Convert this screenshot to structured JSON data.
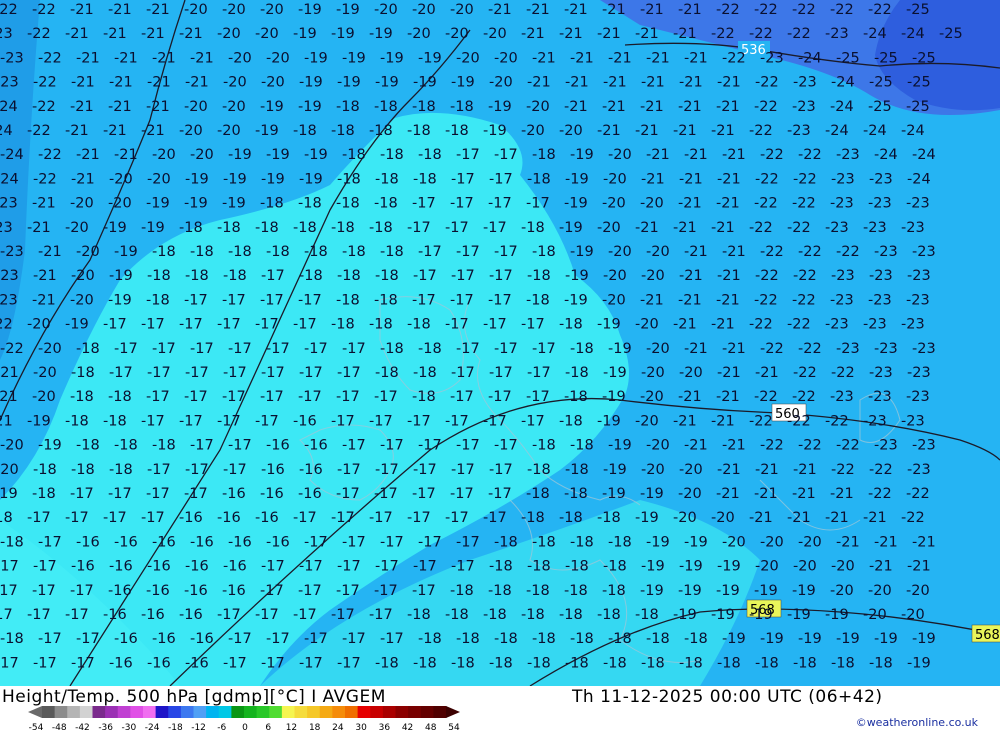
{
  "header": {
    "title_left": "Height/Temp. 500 hPa [gdmp][°C] I AVGEM",
    "title_right": "Th 11-12-2025 00:00 UTC (06+42)",
    "credit": "©weatheronline.co.uk"
  },
  "colorbar": {
    "labels": [
      "-54",
      "-48",
      "-42",
      "-36",
      "-30",
      "-24",
      "-18",
      "-12",
      "-6",
      "0",
      "6",
      "12",
      "18",
      "24",
      "30",
      "36",
      "42",
      "48",
      "54"
    ],
    "colors": [
      "#5a5a5a",
      "#8c8c8c",
      "#b4b4b4",
      "#d2d2d2",
      "#7a2a8c",
      "#9b30b4",
      "#c040d2",
      "#e050e6",
      "#f06ef0",
      "#1e14c8",
      "#2846e6",
      "#3c78f0",
      "#50a0f5",
      "#00b4f0",
      "#00c8e6",
      "#0a9614",
      "#14b41e",
      "#28c828",
      "#50dc32",
      "#f5f550",
      "#f5dc3c",
      "#f5c828",
      "#f5aa14",
      "#f58c0a",
      "#f06e00",
      "#e60000",
      "#c80000",
      "#aa0000",
      "#8c0000",
      "#780000",
      "#640000",
      "#500000"
    ]
  },
  "contour_labels": [
    "536",
    "560",
    "568",
    "568"
  ],
  "temperature_grid": [
    [
      "-22",
      "-22",
      "-21",
      "-21",
      "-21",
      "-20",
      "-20",
      "-20",
      "-19",
      "-19",
      "-20",
      "-20",
      "-20",
      "-21",
      "-21",
      "-21",
      "-21",
      "-21",
      "-21",
      "-22",
      "-22",
      "-22",
      "-22",
      "-22",
      "-25"
    ],
    [
      "-23",
      "-22",
      "-21",
      "-21",
      "-21",
      "-21",
      "-20",
      "-20",
      "-19",
      "-19",
      "-19",
      "-20",
      "-20",
      "-20",
      "-21",
      "-21",
      "-21",
      "-21",
      "-21",
      "-22",
      "-22",
      "-22",
      "-23",
      "-24",
      "-24",
      "-25"
    ],
    [
      "-23",
      "-22",
      "-21",
      "-21",
      "-21",
      "-21",
      "-20",
      "-20",
      "-19",
      "-19",
      "-19",
      "-19",
      "-20",
      "-20",
      "-21",
      "-21",
      "-21",
      "-21",
      "-21",
      "-22",
      "-23",
      "-24",
      "-25",
      "-25",
      "-25"
    ],
    [
      "-23",
      "-22",
      "-21",
      "-21",
      "-21",
      "-21",
      "-20",
      "-20",
      "-19",
      "-19",
      "-19",
      "-19",
      "-19",
      "-20",
      "-21",
      "-21",
      "-21",
      "-21",
      "-21",
      "-21",
      "-22",
      "-23",
      "-24",
      "-25",
      "-25"
    ],
    [
      "-24",
      "-22",
      "-21",
      "-21",
      "-21",
      "-20",
      "-20",
      "-19",
      "-19",
      "-18",
      "-18",
      "-18",
      "-18",
      "-19",
      "-20",
      "-21",
      "-21",
      "-21",
      "-21",
      "-21",
      "-22",
      "-23",
      "-24",
      "-25",
      "-25"
    ],
    [
      "-24",
      "-22",
      "-21",
      "-21",
      "-21",
      "-20",
      "-20",
      "-19",
      "-18",
      "-18",
      "-18",
      "-18",
      "-18",
      "-19",
      "-20",
      "-20",
      "-21",
      "-21",
      "-21",
      "-21",
      "-22",
      "-23",
      "-24",
      "-24",
      "-24"
    ],
    [
      "-24",
      "-22",
      "-21",
      "-21",
      "-20",
      "-20",
      "-19",
      "-19",
      "-19",
      "-18",
      "-18",
      "-18",
      "-17",
      "-17",
      "-18",
      "-19",
      "-20",
      "-21",
      "-21",
      "-21",
      "-22",
      "-22",
      "-23",
      "-24",
      "-24"
    ],
    [
      "-24",
      "-22",
      "-21",
      "-20",
      "-20",
      "-19",
      "-19",
      "-19",
      "-19",
      "-18",
      "-18",
      "-18",
      "-17",
      "-17",
      "-18",
      "-19",
      "-20",
      "-21",
      "-21",
      "-21",
      "-22",
      "-22",
      "-23",
      "-23",
      "-24"
    ],
    [
      "-23",
      "-21",
      "-20",
      "-20",
      "-19",
      "-19",
      "-19",
      "-18",
      "-18",
      "-18",
      "-18",
      "-17",
      "-17",
      "-17",
      "-17",
      "-19",
      "-20",
      "-20",
      "-21",
      "-21",
      "-22",
      "-22",
      "-23",
      "-23",
      "-23"
    ],
    [
      "-23",
      "-21",
      "-20",
      "-19",
      "-19",
      "-18",
      "-18",
      "-18",
      "-18",
      "-18",
      "-18",
      "-17",
      "-17",
      "-17",
      "-18",
      "-19",
      "-20",
      "-21",
      "-21",
      "-21",
      "-22",
      "-22",
      "-23",
      "-23",
      "-23"
    ],
    [
      "-23",
      "-21",
      "-20",
      "-19",
      "-18",
      "-18",
      "-18",
      "-18",
      "-18",
      "-18",
      "-18",
      "-17",
      "-17",
      "-17",
      "-18",
      "-19",
      "-20",
      "-20",
      "-21",
      "-21",
      "-22",
      "-22",
      "-22",
      "-23",
      "-23"
    ],
    [
      "-23",
      "-21",
      "-20",
      "-19",
      "-18",
      "-18",
      "-18",
      "-17",
      "-18",
      "-18",
      "-18",
      "-17",
      "-17",
      "-17",
      "-18",
      "-19",
      "-20",
      "-20",
      "-21",
      "-21",
      "-22",
      "-22",
      "-23",
      "-23",
      "-23"
    ],
    [
      "-23",
      "-21",
      "-20",
      "-19",
      "-18",
      "-17",
      "-17",
      "-17",
      "-17",
      "-18",
      "-18",
      "-17",
      "-17",
      "-17",
      "-18",
      "-19",
      "-20",
      "-21",
      "-21",
      "-21",
      "-22",
      "-22",
      "-23",
      "-23",
      "-23"
    ],
    [
      "-22",
      "-20",
      "-19",
      "-17",
      "-17",
      "-17",
      "-17",
      "-17",
      "-17",
      "-18",
      "-18",
      "-18",
      "-17",
      "-17",
      "-17",
      "-18",
      "-19",
      "-20",
      "-21",
      "-21",
      "-22",
      "-22",
      "-23",
      "-23",
      "-23"
    ],
    [
      "-22",
      "-20",
      "-18",
      "-17",
      "-17",
      "-17",
      "-17",
      "-17",
      "-17",
      "-17",
      "-18",
      "-18",
      "-17",
      "-17",
      "-17",
      "-18",
      "-19",
      "-20",
      "-21",
      "-21",
      "-22",
      "-22",
      "-23",
      "-23",
      "-23"
    ],
    [
      "-21",
      "-20",
      "-18",
      "-17",
      "-17",
      "-17",
      "-17",
      "-17",
      "-17",
      "-17",
      "-18",
      "-18",
      "-17",
      "-17",
      "-17",
      "-18",
      "-19",
      "-20",
      "-20",
      "-21",
      "-21",
      "-22",
      "-22",
      "-23",
      "-23"
    ],
    [
      "-21",
      "-20",
      "-18",
      "-18",
      "-17",
      "-17",
      "-17",
      "-17",
      "-17",
      "-17",
      "-17",
      "-18",
      "-17",
      "-17",
      "-17",
      "-18",
      "-19",
      "-20",
      "-21",
      "-21",
      "-22",
      "-22",
      "-23",
      "-23",
      "-23"
    ],
    [
      "-21",
      "-19",
      "-18",
      "-18",
      "-17",
      "-17",
      "-17",
      "-17",
      "-16",
      "-17",
      "-17",
      "-17",
      "-17",
      "-17",
      "-17",
      "-18",
      "-19",
      "-20",
      "-21",
      "-21",
      "-22",
      "-22",
      "-22",
      "-23",
      "-23"
    ],
    [
      "-20",
      "-19",
      "-18",
      "-18",
      "-18",
      "-17",
      "-17",
      "-16",
      "-16",
      "-17",
      "-17",
      "-17",
      "-17",
      "-17",
      "-18",
      "-18",
      "-19",
      "-20",
      "-21",
      "-21",
      "-22",
      "-22",
      "-22",
      "-23",
      "-23"
    ],
    [
      "-20",
      "-18",
      "-18",
      "-18",
      "-17",
      "-17",
      "-17",
      "-16",
      "-16",
      "-17",
      "-17",
      "-17",
      "-17",
      "-17",
      "-18",
      "-18",
      "-19",
      "-20",
      "-20",
      "-21",
      "-21",
      "-21",
      "-22",
      "-22",
      "-23"
    ],
    [
      "-19",
      "-18",
      "-17",
      "-17",
      "-17",
      "-17",
      "-16",
      "-16",
      "-16",
      "-17",
      "-17",
      "-17",
      "-17",
      "-17",
      "-18",
      "-18",
      "-19",
      "-19",
      "-20",
      "-21",
      "-21",
      "-21",
      "-21",
      "-22",
      "-22"
    ],
    [
      "-18",
      "-17",
      "-17",
      "-17",
      "-17",
      "-16",
      "-16",
      "-16",
      "-17",
      "-17",
      "-17",
      "-17",
      "-17",
      "-17",
      "-18",
      "-18",
      "-18",
      "-19",
      "-20",
      "-20",
      "-21",
      "-21",
      "-21",
      "-21",
      "-22"
    ],
    [
      "-18",
      "-17",
      "-16",
      "-16",
      "-16",
      "-16",
      "-16",
      "-16",
      "-17",
      "-17",
      "-17",
      "-17",
      "-17",
      "-18",
      "-18",
      "-18",
      "-18",
      "-19",
      "-19",
      "-20",
      "-20",
      "-20",
      "-21",
      "-21",
      "-21"
    ],
    [
      "-17",
      "-17",
      "-16",
      "-16",
      "-16",
      "-16",
      "-16",
      "-17",
      "-17",
      "-17",
      "-17",
      "-17",
      "-17",
      "-18",
      "-18",
      "-18",
      "-18",
      "-19",
      "-19",
      "-19",
      "-20",
      "-20",
      "-20",
      "-21",
      "-21"
    ],
    [
      "-17",
      "-17",
      "-17",
      "-16",
      "-16",
      "-16",
      "-16",
      "-17",
      "-17",
      "-17",
      "-17",
      "-17",
      "-18",
      "-18",
      "-18",
      "-18",
      "-18",
      "-19",
      "-19",
      "-19",
      "-19",
      "-19",
      "-20",
      "-20",
      "-20"
    ],
    [
      "-17",
      "-17",
      "-17",
      "-16",
      "-16",
      "-16",
      "-17",
      "-17",
      "-17",
      "-17",
      "-17",
      "-18",
      "-18",
      "-18",
      "-18",
      "-18",
      "-18",
      "-18",
      "-19",
      "-19",
      "-19",
      "-19",
      "-19",
      "-20",
      "-20"
    ],
    [
      "-18",
      "-17",
      "-17",
      "-16",
      "-16",
      "-16",
      "-17",
      "-17",
      "-17",
      "-17",
      "-17",
      "-18",
      "-18",
      "-18",
      "-18",
      "-18",
      "-18",
      "-18",
      "-18",
      "-19",
      "-19",
      "-19",
      "-19",
      "-19",
      "-19"
    ],
    [
      "-17",
      "-17",
      "-17",
      "-16",
      "-16",
      "-16",
      "-17",
      "-17",
      "-17",
      "-17",
      "-18",
      "-18",
      "-18",
      "-18",
      "-18",
      "-18",
      "-18",
      "-18",
      "-18",
      "-18",
      "-18",
      "-18",
      "-18",
      "-18",
      "-19"
    ]
  ]
}
